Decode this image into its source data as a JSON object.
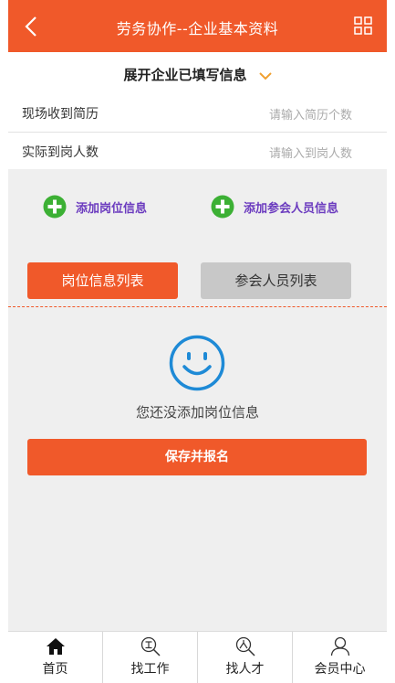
{
  "header": {
    "title": "劳务协作--企业基本资料"
  },
  "expand": {
    "label": "展开企业已填写信息"
  },
  "fields": [
    {
      "label": "现场收到简历",
      "placeholder": "请输入简历个数"
    },
    {
      "label": "实际到岗人数",
      "placeholder": "请输入到岗人数"
    }
  ],
  "actions": {
    "add_position": "添加岗位信息",
    "add_attendee": "添加参会人员信息"
  },
  "tabs": [
    {
      "label": "岗位信息列表",
      "active": true
    },
    {
      "label": "参会人员列表",
      "active": false
    }
  ],
  "empty": {
    "text": "您还没添加岗位信息"
  },
  "save": {
    "label": "保存并报名"
  },
  "bottom_nav": [
    {
      "label": "首页",
      "icon": "home-icon"
    },
    {
      "label": "找工作",
      "icon": "find-job-icon"
    },
    {
      "label": "找人才",
      "icon": "find-talent-icon"
    },
    {
      "label": "会员中心",
      "icon": "user-icon"
    }
  ],
  "colors": {
    "accent": "#f0592a",
    "add_green": "#3cb034",
    "link_purple": "#6b3bbf",
    "smile_blue": "#1e8ad6"
  }
}
